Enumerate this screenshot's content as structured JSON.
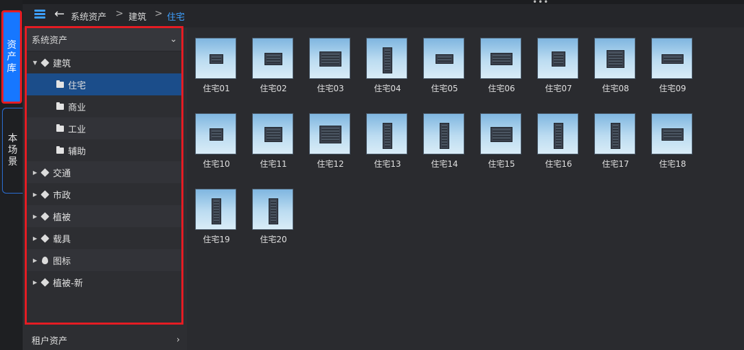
{
  "rail": {
    "asset_tab": [
      "资",
      "产",
      "库"
    ],
    "scene_tab": [
      "本",
      "场",
      "景"
    ]
  },
  "header": {
    "breadcrumb": [
      "系统资产",
      "建筑",
      "住宅"
    ],
    "separator": ">",
    "accent_color": "#3ea0ff"
  },
  "tree": {
    "root_label": "系统资产",
    "items": [
      {
        "label": "建筑",
        "level": 0,
        "icon": "cube-icon",
        "expanded": true
      },
      {
        "label": "住宅",
        "level": 1,
        "icon": "folder-icon",
        "selected": true
      },
      {
        "label": "商业",
        "level": 1,
        "icon": "folder-icon"
      },
      {
        "label": "工业",
        "level": 1,
        "icon": "folder-icon"
      },
      {
        "label": "辅助",
        "level": 1,
        "icon": "folder-icon"
      },
      {
        "label": "交通",
        "level": 0,
        "icon": "cube-icon"
      },
      {
        "label": "市政",
        "level": 0,
        "icon": "cube-icon"
      },
      {
        "label": "植被",
        "level": 0,
        "icon": "cube-icon"
      },
      {
        "label": "载具",
        "level": 0,
        "icon": "cube-icon"
      },
      {
        "label": "图标",
        "level": 0,
        "icon": "pin-icon"
      },
      {
        "label": "植被-新",
        "level": 0,
        "icon": "cube-icon"
      }
    ],
    "tenant_label": "租户资产"
  },
  "assets": [
    "住宅01",
    "住宅02",
    "住宅03",
    "住宅04",
    "住宅05",
    "住宅06",
    "住宅07",
    "住宅08",
    "住宅09",
    "住宅10",
    "住宅11",
    "住宅12",
    "住宅13",
    "住宅14",
    "住宅15",
    "住宅16",
    "住宅17",
    "住宅18",
    "住宅19",
    "住宅20"
  ],
  "colors": {
    "selected_row": "#1b4d8a",
    "active_tab": "#1677ff",
    "highlight_border": "#e51c23"
  }
}
